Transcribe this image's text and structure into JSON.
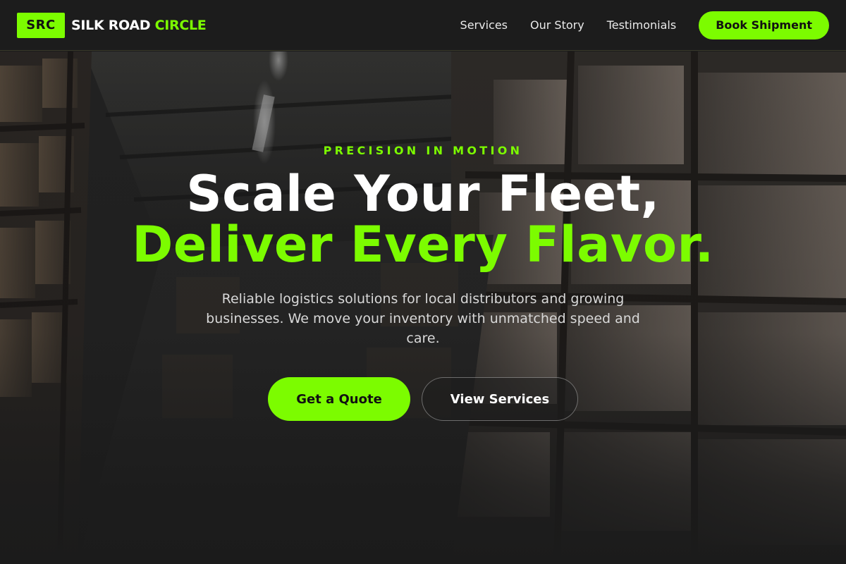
{
  "brand": {
    "badge": "SRC",
    "name_main": "SILK ROAD",
    "name_accent": "CIRCLE"
  },
  "nav": {
    "links": [
      "Services",
      "Our Story",
      "Testimonials"
    ],
    "cta_label": "Book Shipment"
  },
  "hero": {
    "eyebrow": "PRECISION IN MOTION",
    "headline_line1": "Scale Your Fleet,",
    "headline_line2": "Deliver Every Flavor.",
    "subtext": "Reliable logistics solutions for local distributors and growing businesses. We move your inventory with unmatched speed and care.",
    "primary_cta": "Get a Quote",
    "secondary_cta": "View Services"
  },
  "colors": {
    "accent": "#7cfc00",
    "background": "#1b1b1b",
    "text": "#ffffff"
  },
  "icons": {
    "background_image": "warehouse-shelves-photo"
  }
}
